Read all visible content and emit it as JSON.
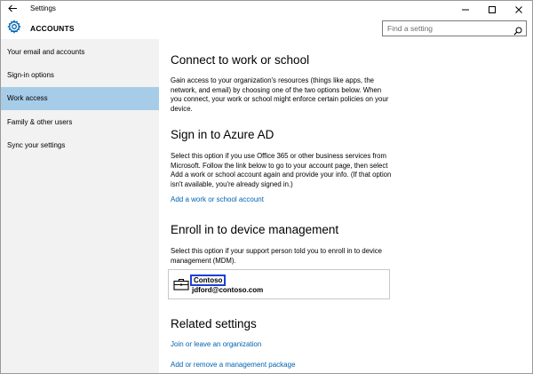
{
  "window": {
    "title": "Settings",
    "controls": [
      "minimize-icon",
      "maximize-icon",
      "close-icon"
    ]
  },
  "header": {
    "app_heading": "ACCOUNTS",
    "search_placeholder": "Find a setting",
    "search_value": ""
  },
  "sidebar": {
    "items": [
      {
        "label": "Your email and accounts",
        "selected": false
      },
      {
        "label": "Sign-in options",
        "selected": false
      },
      {
        "label": "Work access",
        "selected": true
      },
      {
        "label": "Family & other users",
        "selected": false
      },
      {
        "label": "Sync your settings",
        "selected": false
      }
    ]
  },
  "main": {
    "connect": {
      "heading": "Connect to work or school",
      "body": "Gain access to your organization's resources (things like apps, the network, and email) by choosing one of the two options below. When you connect, your work or school might enforce certain policies on your device."
    },
    "azure": {
      "heading": "Sign in to Azure AD",
      "body": "Select this option if you use Office 365 or other business services from Microsoft. Follow the link below to go to your account page, then select Add a work or school account again and provide your info. (If that option isn't available, you're already signed in.)",
      "link": "Add a work or school account"
    },
    "enroll": {
      "heading": "Enroll in to device management",
      "body": "Select this option if your support person told you to enroll in to device management (MDM).",
      "account": {
        "org": "Contoso",
        "email": "jdford@contoso.com",
        "icon": "briefcase-icon"
      }
    },
    "related": {
      "heading": "Related settings",
      "links": [
        "Join or leave an organization",
        "Add or remove a management package"
      ]
    }
  },
  "colors": {
    "selected_nav": "#a7cce8",
    "sidebar_bg": "#f2f2f2",
    "link": "#0063b1",
    "highlight_box": "#1f3fd6"
  }
}
